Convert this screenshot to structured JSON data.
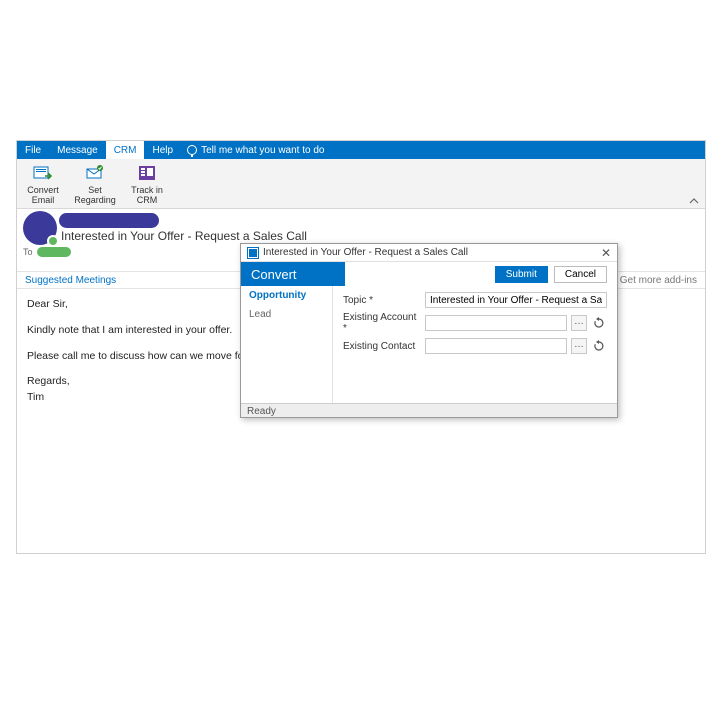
{
  "menubar": {
    "tabs": [
      {
        "label": "File"
      },
      {
        "label": "Message"
      },
      {
        "label": "CRM"
      },
      {
        "label": "Help"
      }
    ],
    "tell_me": "Tell me what you want to do"
  },
  "ribbon": {
    "convert_email": "Convert Email",
    "set_regarding": "Set Regarding",
    "track_in_crm": "Track in CRM"
  },
  "email": {
    "subject": "Interested in Your Offer - Request a Sales Call",
    "to_label": "To",
    "suggested_meetings": "Suggested Meetings",
    "get_more_addins": "Get more add-ins",
    "body": {
      "greeting": "Dear Sir,",
      "line1": "Kindly note that I am interested in your offer.",
      "line2": "Please call me to discuss how can we move forward.",
      "signoff": "Regards,",
      "name": "Tim"
    }
  },
  "dialog": {
    "title": "Interested in Your Offer - Request a Sales Call",
    "header": "Convert",
    "submit": "Submit",
    "cancel": "Cancel",
    "side": {
      "opportunity": "Opportunity",
      "lead": "Lead"
    },
    "form": {
      "topic_label": "Topic *",
      "topic_value": "Interested in Your Offer - Request a Sales Call",
      "account_label": "Existing Account *",
      "account_value": "",
      "contact_label": "Existing Contact",
      "contact_value": ""
    },
    "status": "Ready"
  }
}
